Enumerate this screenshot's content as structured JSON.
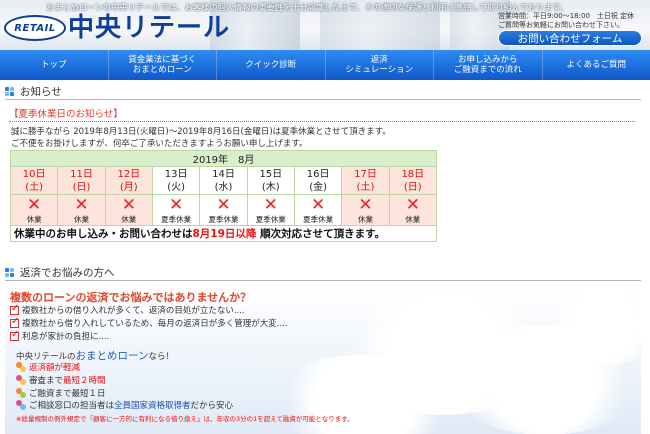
{
  "header": {
    "tagline": "おまとめローンの中央リテールでは、お客様の個人情報の重要性を十分認識した上で、その適切な保護と利用に徹底して取り組んでおります。",
    "logo_badge": "RETAIL",
    "logo_text": "中央リテール",
    "hours_line1": "営業時間：平日9:00～18:00　土日祝 定休",
    "hours_line2": "ご質問等お気軽にお問い合わせ下さい。",
    "contact_button": "お問い合わせフォーム"
  },
  "nav": {
    "items": [
      {
        "label": "トップ"
      },
      {
        "label": "貸金業法に基づく\nおまとめローン"
      },
      {
        "label": "クイック診断"
      },
      {
        "label": "返済\nシミュレーション"
      },
      {
        "label": "お申し込みから\nご融資までの流れ"
      },
      {
        "label": "よくあるご質問"
      }
    ]
  },
  "notice": {
    "section_title": "お知らせ",
    "title": "【夏季休業日のお知らせ】",
    "line1": "誠に勝手ながら 2019年8月13日(火曜日)～2019年8月16日(金曜日)は夏季休業とさせて頂きます。",
    "line2": "ご不便をお掛けしますが、何卒ご了承いただきますようお願い申し上げます。"
  },
  "calendar": {
    "month": "2019年　8月",
    "days": [
      {
        "date": "10日",
        "weekday": "(土)",
        "status": "休業",
        "weekend": true
      },
      {
        "date": "11日",
        "weekday": "(日)",
        "status": "休業",
        "weekend": true
      },
      {
        "date": "12日",
        "weekday": "(月)",
        "status": "休業",
        "weekend": true
      },
      {
        "date": "13日",
        "weekday": "(火)",
        "status": "夏季休業",
        "weekend": false
      },
      {
        "date": "14日",
        "weekday": "(水)",
        "status": "夏季休業",
        "weekend": false
      },
      {
        "date": "15日",
        "weekday": "(木)",
        "status": "夏季休業",
        "weekend": false
      },
      {
        "date": "16日",
        "weekday": "(金)",
        "status": "夏季休業",
        "weekend": false
      },
      {
        "date": "17日",
        "weekday": "(土)",
        "status": "休業",
        "weekend": true
      },
      {
        "date": "18日",
        "weekday": "(日)",
        "status": "休業",
        "weekend": true
      }
    ],
    "mark": "✕",
    "footer_before": "休業中のお申し込み・お問い合わせは",
    "footer_highlight": "8月19日以降",
    "footer_after": " 順次対応させて頂きます。"
  },
  "repay": {
    "section_title": "返済でお悩みの方へ",
    "headline": "複数のローンの返済でお悩みではありませんか？",
    "checks": [
      "複数社からの借り入れが多くて、返済の目処が立たない....",
      "複数社から借り入れしているため、毎月の返済日が多く管理が大変....",
      "利息が家計の負担に...."
    ],
    "omatome_prefix": "中央リテールの",
    "omatome_highlight": "おまとめローン",
    "omatome_suffix": "なら！",
    "features": [
      {
        "parts": [
          {
            "t": "返済額が軽減",
            "c": "red"
          }
        ]
      },
      {
        "parts": [
          {
            "t": "審査まで",
            "c": "blk"
          },
          {
            "t": "最短２時間",
            "c": "red"
          }
        ]
      },
      {
        "parts": [
          {
            "t": "ご融資まで最短１日",
            "c": "blk"
          }
        ]
      },
      {
        "parts": [
          {
            "t": "ご相談窓口の担当者は",
            "c": "blk"
          },
          {
            "t": "全員国家資格取得者",
            "c": "blu"
          },
          {
            "t": "だから安心",
            "c": "blk"
          }
        ]
      }
    ],
    "footnote": "※総量規制の例外規定で「顧客に一方的に有利になる借り換え」は、年収の3分の1を超えて融資が可能となります。"
  },
  "colors": {
    "brand_blue": "#0d3f9a",
    "nav_blue": "#1b6fde",
    "accent_red": "#e63b2e",
    "calendar_green": "#d9eecb",
    "weekend_pink": "#fde5dc"
  }
}
